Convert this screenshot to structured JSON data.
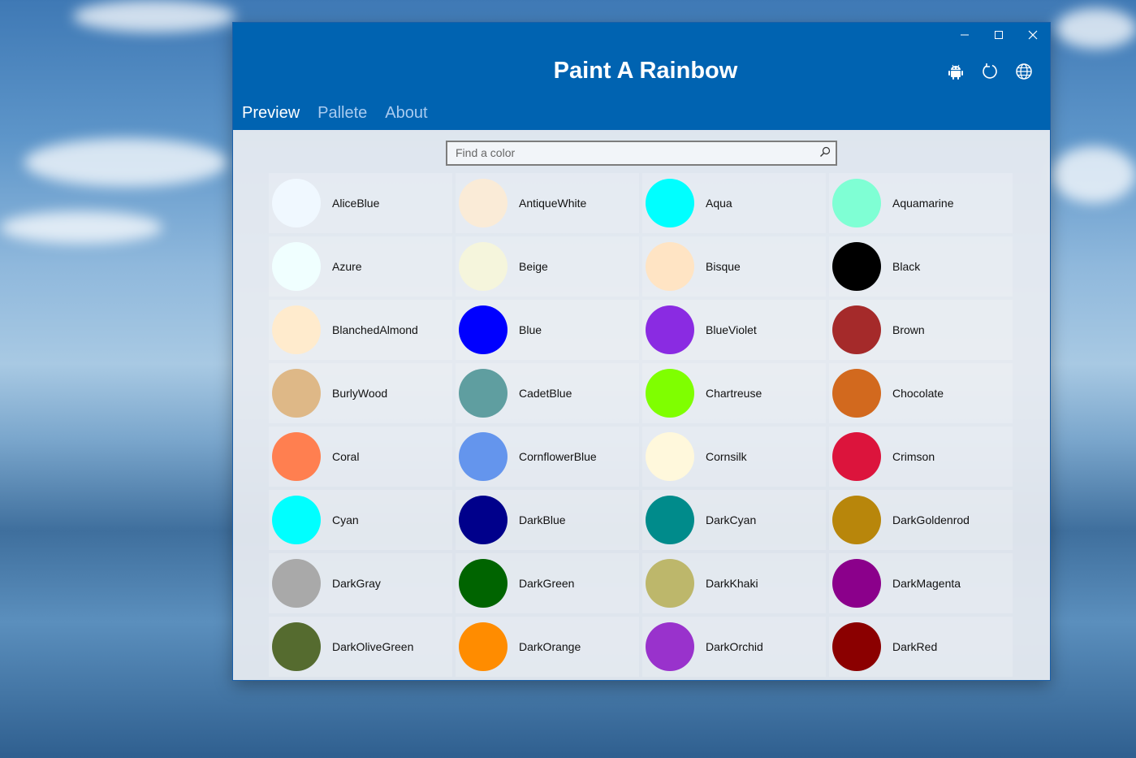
{
  "app": {
    "title": "Paint A Rainbow"
  },
  "window_controls": [
    "minimize-icon",
    "maximize-icon",
    "close-icon"
  ],
  "header_icons": [
    "android-icon",
    "refresh-icon",
    "globe-icon"
  ],
  "tabs": [
    {
      "label": "Preview",
      "active": true
    },
    {
      "label": "Pallete",
      "active": false
    },
    {
      "label": "About",
      "active": false
    }
  ],
  "search": {
    "placeholder": "Find a color"
  },
  "colors": [
    {
      "name": "AliceBlue",
      "hex": "#F0F8FF"
    },
    {
      "name": "AntiqueWhite",
      "hex": "#FAEBD7"
    },
    {
      "name": "Aqua",
      "hex": "#00FFFF"
    },
    {
      "name": "Aquamarine",
      "hex": "#7FFFD4"
    },
    {
      "name": "Azure",
      "hex": "#F0FFFF"
    },
    {
      "name": "Beige",
      "hex": "#F5F5DC"
    },
    {
      "name": "Bisque",
      "hex": "#FFE4C4"
    },
    {
      "name": "Black",
      "hex": "#000000"
    },
    {
      "name": "BlanchedAlmond",
      "hex": "#FFEBCD"
    },
    {
      "name": "Blue",
      "hex": "#0000FF"
    },
    {
      "name": "BlueViolet",
      "hex": "#8A2BE2"
    },
    {
      "name": "Brown",
      "hex": "#A52A2A"
    },
    {
      "name": "BurlyWood",
      "hex": "#DEB887"
    },
    {
      "name": "CadetBlue",
      "hex": "#5F9EA0"
    },
    {
      "name": "Chartreuse",
      "hex": "#7FFF00"
    },
    {
      "name": "Chocolate",
      "hex": "#D2691E"
    },
    {
      "name": "Coral",
      "hex": "#FF7F50"
    },
    {
      "name": "CornflowerBlue",
      "hex": "#6495ED"
    },
    {
      "name": "Cornsilk",
      "hex": "#FFF8DC"
    },
    {
      "name": "Crimson",
      "hex": "#DC143C"
    },
    {
      "name": "Cyan",
      "hex": "#00FFFF"
    },
    {
      "name": "DarkBlue",
      "hex": "#00008B"
    },
    {
      "name": "DarkCyan",
      "hex": "#008B8B"
    },
    {
      "name": "DarkGoldenrod",
      "hex": "#B8860B"
    },
    {
      "name": "DarkGray",
      "hex": "#A9A9A9"
    },
    {
      "name": "DarkGreen",
      "hex": "#006400"
    },
    {
      "name": "DarkKhaki",
      "hex": "#BDB76B"
    },
    {
      "name": "DarkMagenta",
      "hex": "#8B008B"
    },
    {
      "name": "DarkOliveGreen",
      "hex": "#556B2F"
    },
    {
      "name": "DarkOrange",
      "hex": "#FF8C00"
    },
    {
      "name": "DarkOrchid",
      "hex": "#9932CC"
    },
    {
      "name": "DarkRed",
      "hex": "#8B0000"
    }
  ]
}
